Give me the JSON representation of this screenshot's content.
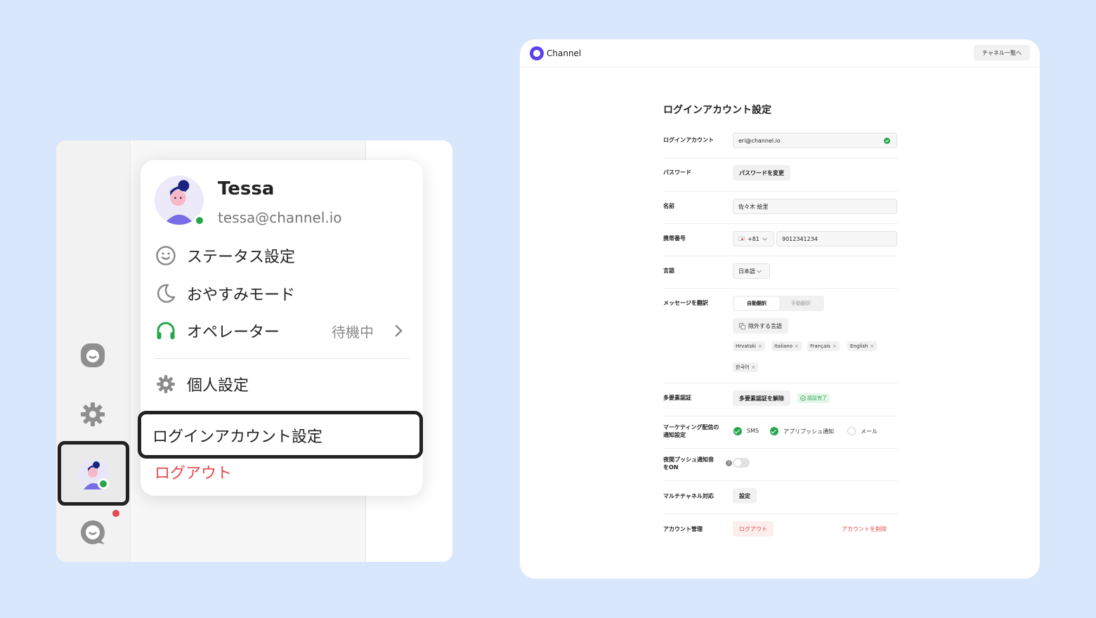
{
  "popup": {
    "name": "Tessa",
    "email": "tessa@channel.io",
    "menu": {
      "status_label": "ステータス設定",
      "sleep_label": "おやすみモード",
      "operator_label": "オペレーター",
      "operator_status": "待機中",
      "personal_label": "個人設定",
      "login_account_label": "ログインアカウント設定",
      "logout_label": "ログアウト"
    }
  },
  "header": {
    "brand": "Channel",
    "channel_list_button": "チャネル一覧へ"
  },
  "settings": {
    "title": "ログインアカウント設定",
    "login_account": {
      "label": "ログインアカウント",
      "value": "eri@channel.io"
    },
    "password": {
      "label": "パスワード",
      "button": "パスワードを変更"
    },
    "name": {
      "label": "名前",
      "value": "佐々木 絵里"
    },
    "phone": {
      "label": "携帯番号",
      "country_code": "+81",
      "number": "9012341234"
    },
    "language": {
      "label": "言語",
      "value": "日本語"
    },
    "translate": {
      "label": "メッセージを翻訳",
      "auto": "自動翻訳",
      "manual": "手動翻訳",
      "exclude_button": "除外する言語",
      "languages": [
        "Hrvatski",
        "Italiano",
        "Français",
        "English",
        "한국어"
      ]
    },
    "mfa": {
      "label": "多要素認証",
      "button": "多要素認証を解除",
      "badge": "認証完了"
    },
    "marketing": {
      "label_line1": "マーケティング配信の",
      "label_line2": "通知設定",
      "options": [
        {
          "label": "SMS",
          "checked": true
        },
        {
          "label": "アプリプッシュ通知",
          "checked": true
        },
        {
          "label": "メール",
          "checked": false
        }
      ]
    },
    "night_push": {
      "label_line1": "夜間プッシュ通知音",
      "label_line2": "をON",
      "enabled": false
    },
    "multichannel": {
      "label": "マルチチャネル対応",
      "button": "設定"
    },
    "account": {
      "label": "アカウント管理",
      "logout": "ログアウト",
      "delete": "アカウントを削除"
    }
  },
  "colors": {
    "background": "#d9e7fd",
    "accent_green": "#26a74a",
    "danger_red": "#e5484d",
    "brand_purple": "#5b3ff0"
  }
}
